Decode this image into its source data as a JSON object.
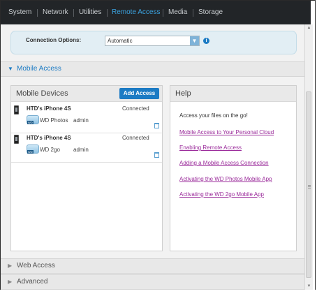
{
  "nav": {
    "items": [
      {
        "label": "System",
        "active": false
      },
      {
        "label": "Network",
        "active": false
      },
      {
        "label": "Utilities",
        "active": false
      },
      {
        "label": "Remote Access",
        "active": true
      },
      {
        "label": "Media",
        "active": false
      },
      {
        "label": "Storage",
        "active": false
      }
    ]
  },
  "connection": {
    "label": "Connection Options:",
    "selected": "Automatic",
    "info_icon": "info-icon"
  },
  "sections": {
    "mobile_access": "Mobile Access",
    "web_access": "Web Access",
    "advanced": "Advanced"
  },
  "devices_panel": {
    "title": "Mobile Devices",
    "add_button": "Add Access",
    "devices": [
      {
        "name": "HTD's iPhone 4S",
        "status": "Connected",
        "app": "WD Photos",
        "user": "admin",
        "app_icon": "wd-photos-icon"
      },
      {
        "name": "HTD's iPhone 4S",
        "status": "Connected",
        "app": "WD 2go",
        "user": "admin",
        "app_icon": "wd-2go-icon"
      }
    ]
  },
  "help_panel": {
    "title": "Help",
    "intro": "Access your files on the go!",
    "links": [
      "Mobile Access to Your Personal Cloud",
      "Enabling Remote Access",
      "Adding a Mobile Access Connection",
      "Activating the WD Photos Mobile App",
      "Activating the WD 2go Mobile App"
    ]
  },
  "colors": {
    "accent": "#1c7bc4",
    "nav_bg": "#222528",
    "link": "#9a2a9a"
  }
}
